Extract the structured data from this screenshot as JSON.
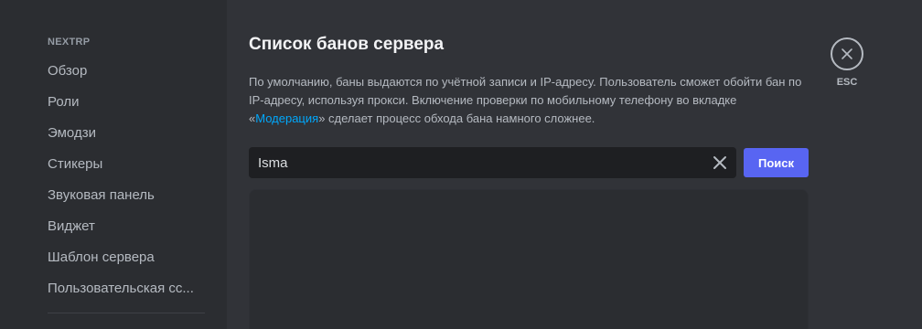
{
  "sidebar": {
    "header": "NEXTRP",
    "items": [
      {
        "label": "Обзор"
      },
      {
        "label": "Роли"
      },
      {
        "label": "Эмодзи"
      },
      {
        "label": "Стикеры"
      },
      {
        "label": "Звуковая панель"
      },
      {
        "label": "Виджет"
      },
      {
        "label": "Шаблон сервера"
      },
      {
        "label": "Пользовательская сс..."
      }
    ]
  },
  "main": {
    "title": "Список банов сервера",
    "description": {
      "text_before": "По умолчанию, баны выдаются по учётной записи и IP-адресу. Пользователь сможет обойти бан по IP-адресу, используя прокси. Включение проверки по мобильному телефону во вкладке «",
      "link": "Модерация",
      "text_after": "» сделает процесс обхода бана намного сложнее."
    },
    "search": {
      "value": "Isma",
      "button_label": "Поиск"
    }
  },
  "close": {
    "label": "ESC"
  },
  "colors": {
    "accent": "#5865f2",
    "link": "#00a8fc",
    "background": "#313338",
    "sidebar": "#2b2d31",
    "input": "#1e1f22"
  }
}
